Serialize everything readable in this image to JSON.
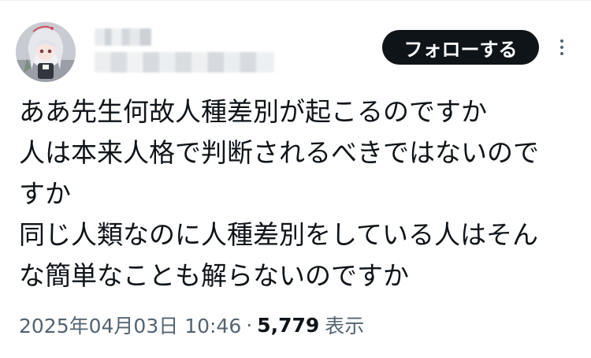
{
  "post": {
    "follow_label": "フォローする",
    "more_icon": "more-dots-icon",
    "text_lines": [
      "ああ先生何故人種差別が起こるのですか",
      "人は本来人格で判断されるべきではないので",
      "すか",
      "同じ人類なのに人種差別をしている人はそん",
      "な簡単なことも解らないのですか"
    ],
    "timestamp": "2025年04月03日 10:46",
    "separator": "·",
    "views_count": "5,779",
    "views_label": "表示"
  },
  "colors": {
    "text_primary": "#0f1419",
    "text_secondary": "#536471",
    "follow_button_bg": "#0f1419",
    "follow_button_text": "#ffffff"
  }
}
